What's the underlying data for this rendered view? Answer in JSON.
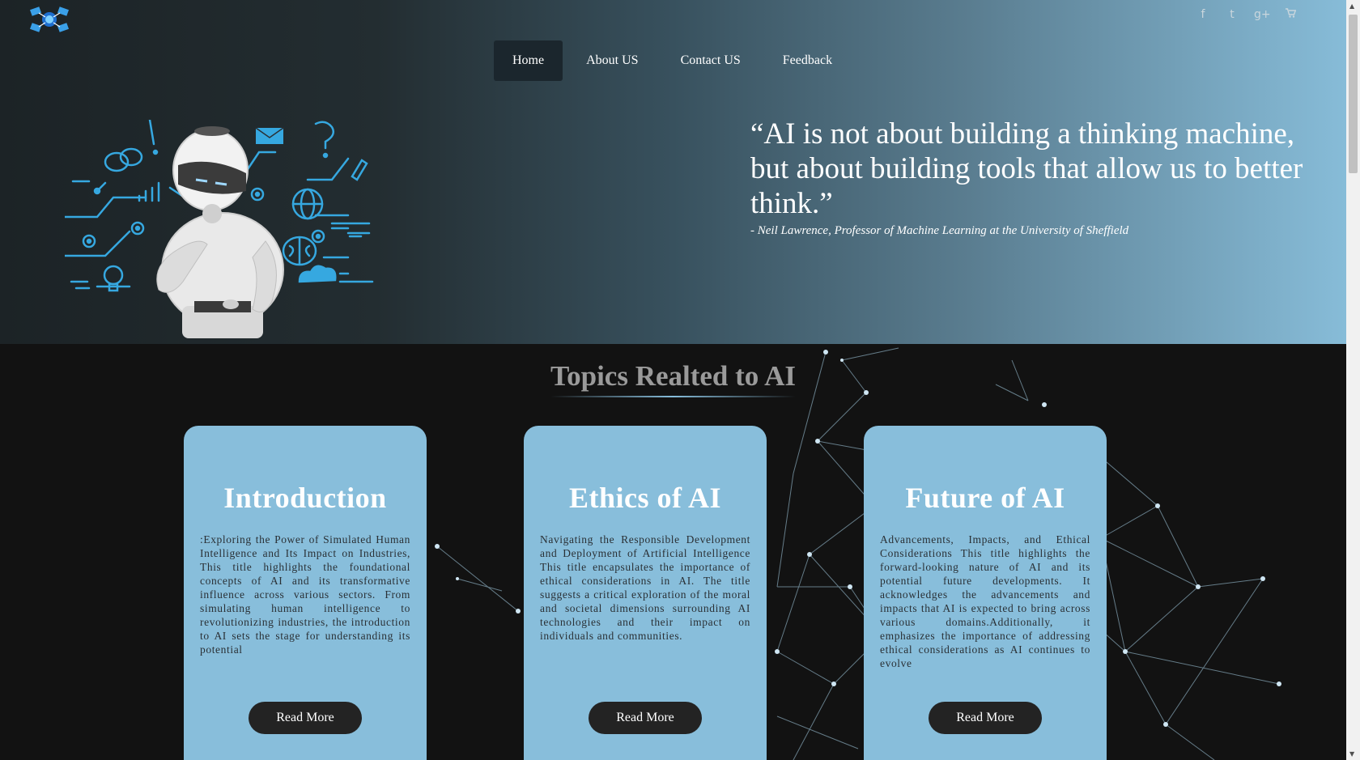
{
  "nav": {
    "items": [
      {
        "label": "Home",
        "active": true
      },
      {
        "label": "About US",
        "active": false
      },
      {
        "label": "Contact US",
        "active": false
      },
      {
        "label": "Feedback",
        "active": false
      }
    ]
  },
  "social": {
    "icons": [
      "facebook-icon",
      "twitter-icon",
      "google-plus-icon",
      "cart-icon"
    ],
    "glyphs": [
      "f",
      "t",
      "g+",
      "▾"
    ]
  },
  "hero": {
    "quote": "“AI is not about building a thinking machine, but about building tools that allow us to better think.”",
    "author": "- Neil Lawrence, Professor of Machine Learning at the University of Sheffield"
  },
  "topics": {
    "title": "Topics Realted to AI",
    "cards": [
      {
        "title": "Introduction",
        "text": ":Exploring the Power of Simulated Human Intelligence and Its Impact on Industries, This title highlights the foundational concepts of AI and its transformative influence across various sectors. From simulating human intelligence to revolutionizing industries, the introduction to AI sets the stage for understanding its potential",
        "button": "Read More"
      },
      {
        "title": "Ethics of AI",
        "text": "Navigating the Responsible Development and Deployment of Artificial Intelligence This title encapsulates the importance of ethical considerations in AI. The title suggests a critical exploration of the moral and societal dimensions surrounding AI technologies and their impact on individuals and communities.",
        "button": "Read More"
      },
      {
        "title": "Future of AI",
        "text": "Advancements, Impacts, and Ethical Considerations This title highlights the forward-looking nature of AI and its potential future developments. It acknowledges the advancements and impacts that AI is expected to bring across various domains.Additionally, it emphasizes the importance of addressing ethical considerations as AI continues to evolve",
        "button": "Read More"
      }
    ]
  },
  "colors": {
    "accent": "#88bedb",
    "nav_active": "#1b262d",
    "button": "#232323",
    "section_bg": "#121212"
  }
}
